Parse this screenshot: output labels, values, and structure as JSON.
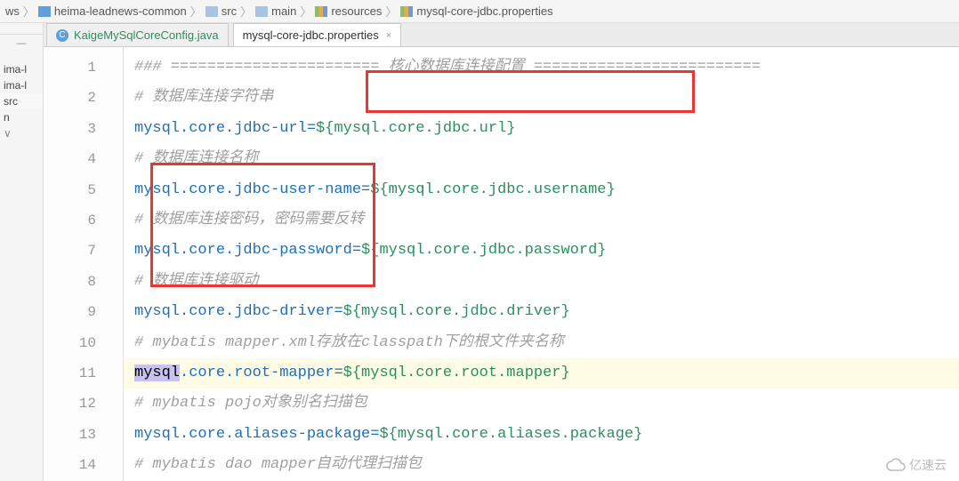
{
  "breadcrumb": {
    "root": "ws",
    "items": [
      "heima-leadnews-common",
      "src",
      "main",
      "resources",
      "mysql-core-jdbc.properties"
    ]
  },
  "sidebar": {
    "items": [
      "ima-l",
      "ima-l",
      "src",
      "n",
      ""
    ]
  },
  "tabs": {
    "tab1": {
      "label": "KaigeMySqlCoreConfig.java",
      "icon": "C"
    },
    "tab2": {
      "label": "mysql-core-jdbc.properties",
      "close": "×"
    }
  },
  "code": {
    "line_numbers": [
      "1",
      "2",
      "3",
      "4",
      "5",
      "6",
      "7",
      "8",
      "9",
      "10",
      "11",
      "12",
      "13",
      "14"
    ],
    "rows": [
      {
        "type": "comment",
        "text": "### ======================= 核心数据库连接配置 ========================="
      },
      {
        "type": "comment",
        "text": "# 数据库连接字符串"
      },
      {
        "type": "kv",
        "key": "mysql.core.jdbc-url",
        "value": "${mysql.core.jdbc.url}"
      },
      {
        "type": "comment",
        "text": "# 数据库连接名称"
      },
      {
        "type": "kv",
        "key": "mysql.core.jdbc-user-name",
        "value": "${mysql.core.jdbc.username}"
      },
      {
        "type": "comment",
        "text": "# 数据库连接密码，密码需要反转"
      },
      {
        "type": "kv",
        "key": "mysql.core.jdbc-password",
        "value": "${mysql.core.jdbc.password}"
      },
      {
        "type": "comment",
        "text": "# 数据库连接驱动"
      },
      {
        "type": "kv",
        "key": "mysql.core.jdbc-driver",
        "value": "${mysql.core.jdbc.driver}"
      },
      {
        "type": "comment",
        "text": "# mybatis mapper.xml存放在classpath下的根文件夹名称"
      },
      {
        "type": "kv_sel",
        "sel": "mysql",
        "key_rest": ".core.root-mapper",
        "value": "${mysql.core.root.mapper}",
        "highlight": true
      },
      {
        "type": "comment",
        "text": "# mybatis pojo对象别名扫描包"
      },
      {
        "type": "kv",
        "key": "mysql.core.aliases-package",
        "value": "${mysql.core.aliases.package}"
      },
      {
        "type": "comment",
        "text": "# mybatis dao mapper自动代理扫描包"
      }
    ]
  },
  "watermark": "亿速云"
}
